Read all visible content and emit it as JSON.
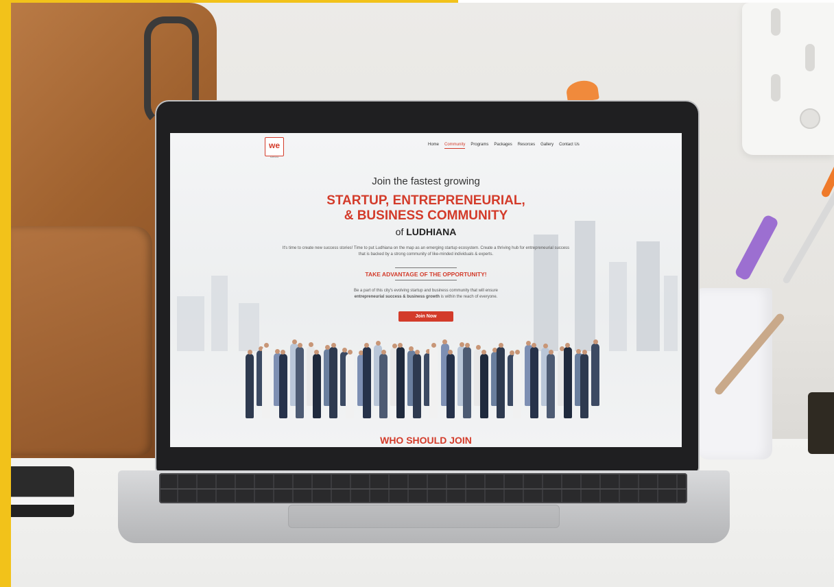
{
  "site": {
    "logo": {
      "text": "we",
      "subtext": "ludhiana"
    },
    "nav": {
      "items": [
        "Home",
        "Community",
        "Programs",
        "Packages",
        "Resorces",
        "Gallery",
        "Contact Us"
      ],
      "active": "Community"
    },
    "hero": {
      "line1": "Join the fastest growing",
      "red_line1": "STARTUP, ENTREPRENEURIAL,",
      "red_line2": "& BUSINESS COMMUNITY",
      "of_prefix": "of",
      "city": "LUDHIANA"
    },
    "description": "It's time to create new success stories! Time to put Ludhiana on the map as an emerging startup ecosystem. Create a thriving hub for entrepreneurial success that is backed by a strong community of like-minded individuals & experts.",
    "opportunity_heading": "TAKE ADVANTAGE OF THE OPPORTUNITY!",
    "opportunity_text_before": "Be a part of this city's evolving startup and business community that will ensure",
    "opportunity_text_bold": "entrepreneurial success & business growth",
    "opportunity_text_after": "is within the reach of everyone.",
    "cta_label": "Join Now",
    "next_section_title": "WHO SHOULD JOIN"
  },
  "colors": {
    "brand_red": "#d33b2a",
    "frame_yellow": "#f2c21a"
  }
}
